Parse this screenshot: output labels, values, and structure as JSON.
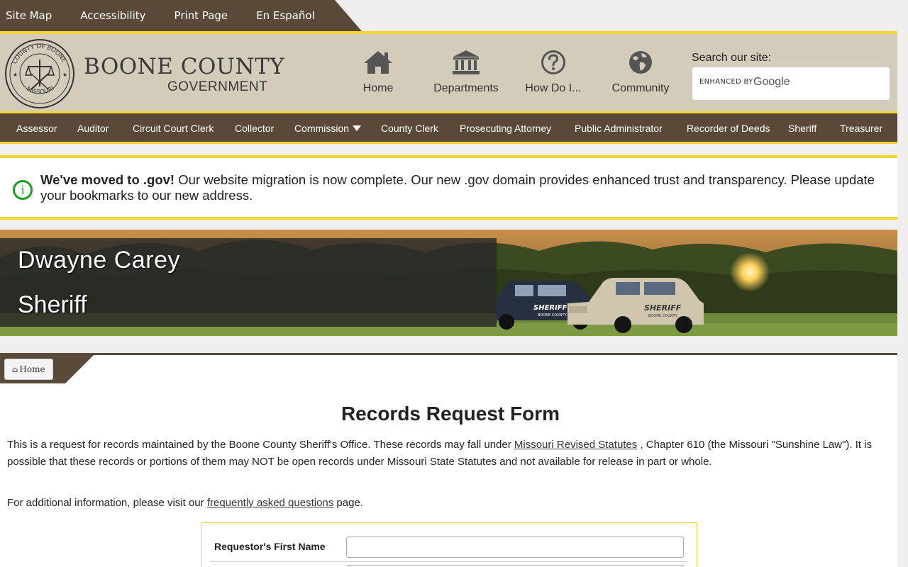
{
  "utility_nav": [
    "Site Map",
    "Accessibility",
    "Print Page",
    "En Español"
  ],
  "header": {
    "brand_line1": "BOONE COUNTY",
    "brand_line2": "GOVERNMENT",
    "seal_text": "COUNTY OF BOONE · MISSOURI",
    "nav": [
      {
        "label": "Home",
        "icon": "home-icon"
      },
      {
        "label": "Departments",
        "icon": "bank-icon"
      },
      {
        "label": "How Do I...",
        "icon": "question-circle-icon"
      },
      {
        "label": "Community",
        "icon": "globe-icon"
      }
    ],
    "search_label": "Search our site:",
    "search_enhanced": "ENHANCED BY",
    "search_brand": "Google"
  },
  "dept_nav": [
    "Assessor",
    "Auditor",
    "Circuit Court Clerk",
    "Collector",
    "Commission",
    "County Clerk",
    "Prosecuting Attorney",
    "Public Administrator",
    "Recorder of Deeds",
    "Sheriff",
    "Treasurer"
  ],
  "alert": {
    "icon": "info-icon",
    "bold": "We've moved to .gov!",
    "text": " Our website migration is now complete. Our new .gov domain provides enhanced trust and transparency. Please update your bookmarks to our new address."
  },
  "banner": {
    "name": "Dwayne Carey",
    "role": "Sheriff",
    "vehicle_text": "SHERIFF",
    "vehicle_subtext": "BOONE COUNTY"
  },
  "breadcrumb": {
    "home": "Home"
  },
  "main": {
    "title": "Records Request Form",
    "intro_before": "This is a request for records maintained by the Boone County Sheriff's Office. These records may fall under ",
    "intro_link": "Missouri Revised Statutes",
    "intro_after": " , Chapter 610 (the Missouri \"Sunshine Law\"). It is possible that these records or portions of them may NOT be open records under Missouri State Statutes and not available for release in part or whole.",
    "info_before": "For additional information, please visit our ",
    "info_link": "frequently asked questions",
    "info_after": " page."
  },
  "form": {
    "first_name_label": "Requestor's First Name",
    "first_name_value": ""
  },
  "colors": {
    "brown": "#5a4939",
    "gold": "#f2d635",
    "tan": "#d4ccbb",
    "success": "#1e9e1e"
  }
}
